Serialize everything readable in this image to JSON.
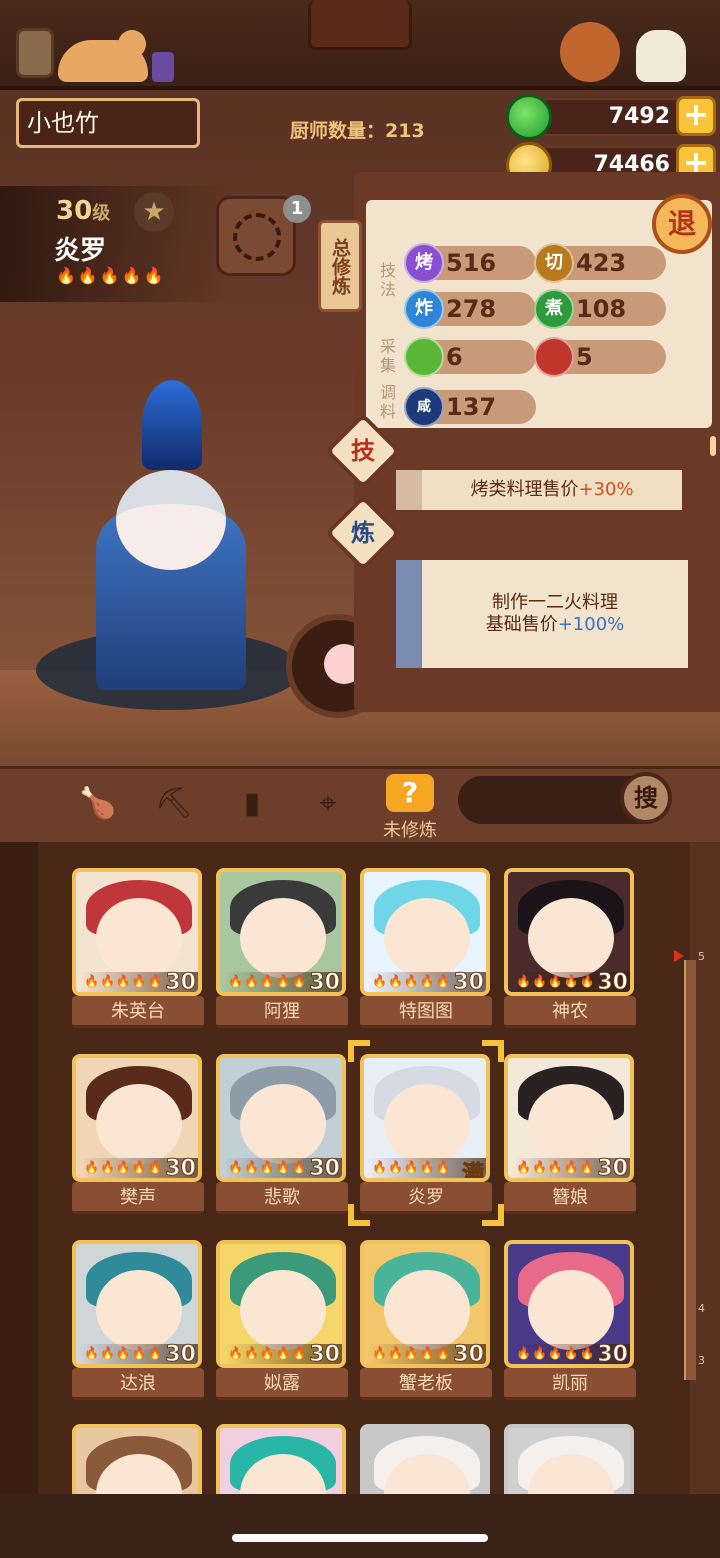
{
  "header": {
    "player_name": "小也竹",
    "chef_count_label": "厨师数量：213",
    "jade": "7492",
    "coins": "74466",
    "plus": "+"
  },
  "character": {
    "level": "30",
    "level_unit": "级",
    "name": "炎罗",
    "star": "★",
    "flames": "🔥🔥🔥🔥🔥",
    "combo_badge": "1"
  },
  "panel": {
    "total_tab": "总修炼",
    "exit": "退",
    "label_skill": "技法",
    "label_gather": "采集",
    "label_season": "调料",
    "stats": [
      {
        "icon": "烤",
        "value": "516",
        "color": "#8a4ed0"
      },
      {
        "icon": "切",
        "value": "423",
        "color": "#b87a1e"
      },
      {
        "icon": "炸",
        "value": "278",
        "color": "#2f86d6"
      },
      {
        "icon": "煮",
        "value": "108",
        "color": "#2e9a3a"
      },
      {
        "icon": "菜",
        "value": "6",
        "color": "#5ab636"
      },
      {
        "icon": "肉",
        "value": "5",
        "color": "#c0362a"
      },
      {
        "icon": "咸",
        "value": "137",
        "color": "#1e3a7a"
      }
    ],
    "skill_btn": "技",
    "train_btn": "炼",
    "bonus1_prefix": "烤类料理售价",
    "bonus1_value": "+30%",
    "bonus2_line1": "制作一二火料理",
    "bonus2_prefix": "基础售价",
    "bonus2_value": "+100%"
  },
  "filter": {
    "active_icon": "?",
    "active_label": "未修炼",
    "search_btn": "搜"
  },
  "cards": [
    {
      "name": "朱英台",
      "level": "30",
      "hair": "#c0363a",
      "bg": "#f3e3d0"
    },
    {
      "name": "阿狸",
      "level": "30",
      "hair": "#3a3a3a",
      "bg": "#a8c6a0"
    },
    {
      "name": "特图图",
      "level": "30",
      "hair": "#6fd6e8",
      "bg": "#e8f4ff"
    },
    {
      "name": "神农",
      "level": "30",
      "hair": "#1a1418",
      "bg": "#4a2a2a"
    },
    {
      "name": "樊声",
      "level": "30",
      "hair": "#5a2a1a",
      "bg": "#f1d6b6"
    },
    {
      "name": "悲歌",
      "level": "30",
      "hair": "#8e9ca8",
      "bg": "#c0d0d6"
    },
    {
      "name": "炎罗",
      "level": "满",
      "hair": "#d6dae2",
      "bg": "#e8eef6"
    },
    {
      "name": "簪娘",
      "level": "30",
      "hair": "#2a2222",
      "bg": "#f4e8d8"
    },
    {
      "name": "达浪",
      "level": "30",
      "hair": "#2f8a9a",
      "bg": "#cfd6d8"
    },
    {
      "name": "姒露",
      "level": "30",
      "hair": "#3a9a7a",
      "bg": "#f4d66a"
    },
    {
      "name": "蟹老板",
      "level": "30",
      "hair": "#4ab49a",
      "bg": "#f2c66a"
    },
    {
      "name": "凯丽",
      "level": "30",
      "hair": "#e86a8a",
      "bg": "#4a3a8a"
    },
    {
      "name": "",
      "level": "",
      "hair": "#8a5a3a",
      "bg": "#e8c8a0"
    },
    {
      "name": "",
      "level": "",
      "hair": "#2ab6a6",
      "bg": "#f0d0e0"
    },
    {
      "name": "",
      "level": "",
      "hair": "#f4f0ee",
      "bg": "#c8c8c8"
    },
    {
      "name": "",
      "level": "",
      "hair": "#f4f0ee",
      "bg": "#d0d0d0"
    }
  ]
}
